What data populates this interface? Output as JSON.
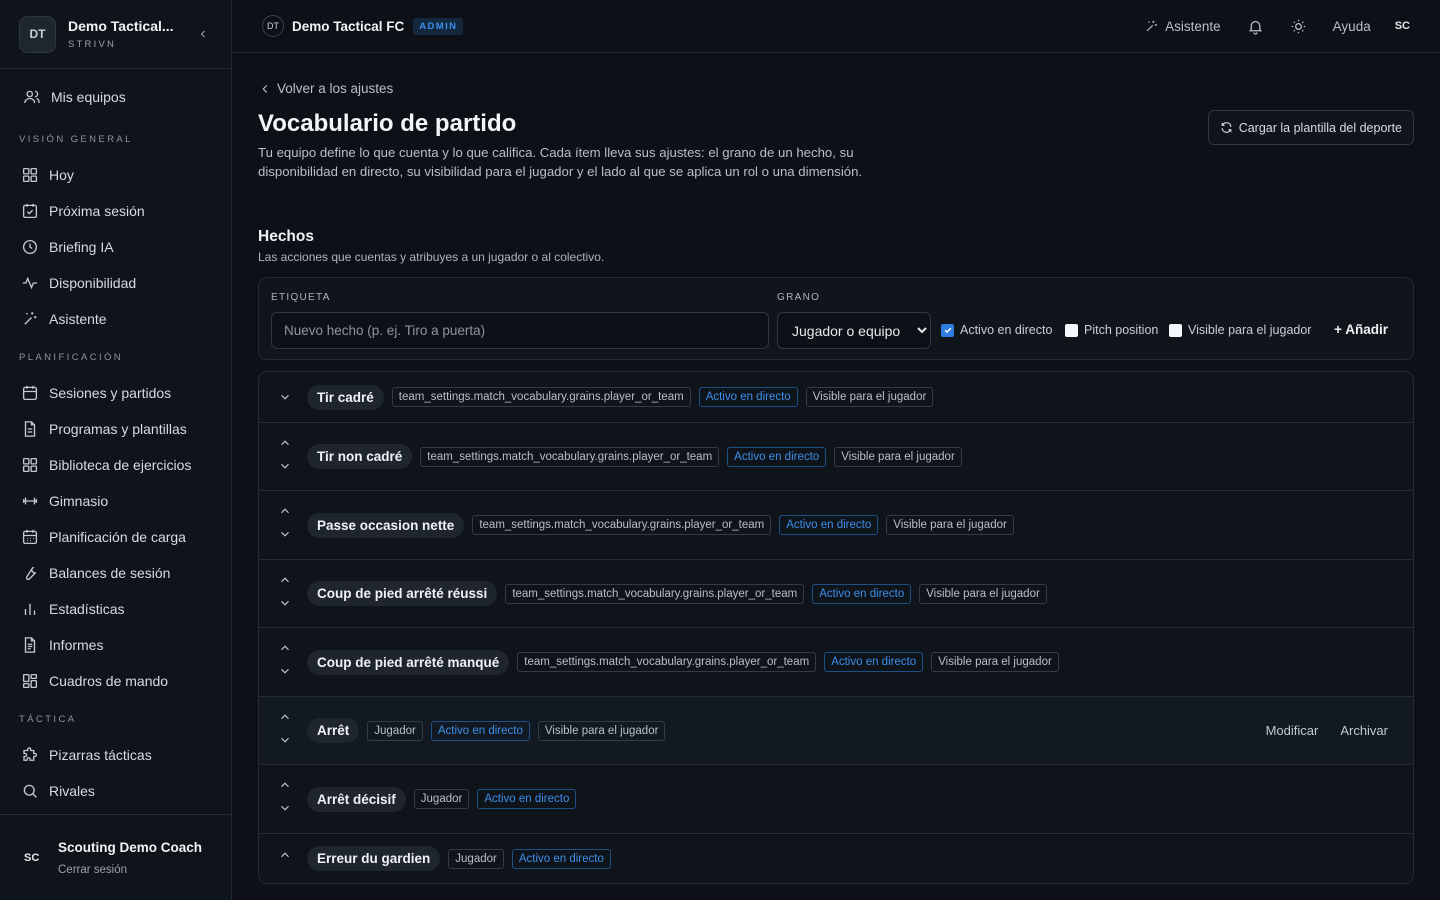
{
  "sidebar": {
    "brand_initials": "DT",
    "brand_name": "Demo Tactical...",
    "brand_sub": "STRIVN",
    "my_teams": "Mis equipos",
    "section_overview": "VISIÓN GENERAL",
    "overview": [
      "Hoy",
      "Próxima sesión",
      "Briefing IA",
      "Disponibilidad",
      "Asistente"
    ],
    "section_planning": "PLANIFICACIÓN",
    "planning": [
      "Sesiones y partidos",
      "Programas y plantillas",
      "Biblioteca de ejercicios",
      "Gimnasio",
      "Planificación de carga",
      "Balances de sesión",
      "Estadísticas",
      "Informes",
      "Cuadros de mando"
    ],
    "section_tactics": "TÁCTICA",
    "tactics": [
      "Pizarras tácticas",
      "Rivales"
    ],
    "user_initials": "SC",
    "user_name": "Scouting Demo Coach",
    "logout": "Cerrar sesión"
  },
  "topbar": {
    "team_initials": "DT",
    "team_name": "Demo Tactical FC",
    "badge": "ADMIN",
    "assistant": "Asistente",
    "help": "Ayuda",
    "me": "SC"
  },
  "main": {
    "back": "Volver a los ajustes",
    "title": "Vocabulario de partido",
    "description": "Tu equipo define lo que cuenta y lo que califica. Cada ítem lleva sus ajustes: el grano de un hecho, su disponibilidad en directo, su visibilidad para el jugador y el lado al que se aplica un rol o una dimensión.",
    "load_template": "Cargar la plantilla del deporte",
    "section_title": "Hechos",
    "section_desc": "Las acciones que cuentas y atribuyes a un jugador o al colectivo.",
    "form": {
      "label_label": "ETIQUETA",
      "label_placeholder": "Nuevo hecho (p. ej. Tiro a puerta)",
      "grain_label": "GRANO",
      "grain_value": "Jugador o equipo",
      "live": "Activo en directo",
      "pitch": "Pitch position",
      "visible": "Visible para el jugador",
      "add": "+ Añadir"
    }
  },
  "facts": [
    {
      "name": "Tir cadré",
      "tags": [
        "team_settings.match_vocabulary.grains.player_or_team",
        "Activo en directo",
        "Visible para el jugador"
      ]
    },
    {
      "name": "Tir non cadré",
      "tags": [
        "team_settings.match_vocabulary.grains.player_or_team",
        "Activo en directo",
        "Visible para el jugador"
      ]
    },
    {
      "name": "Passe occasion nette",
      "tags": [
        "team_settings.match_vocabulary.grains.player_or_team",
        "Activo en directo",
        "Visible para el jugador"
      ]
    },
    {
      "name": "Coup de pied arrêté réussi",
      "tags": [
        "team_settings.match_vocabulary.grains.player_or_team",
        "Activo en directo",
        "Visible para el jugador"
      ]
    },
    {
      "name": "Coup de pied arrêté manqué",
      "tags": [
        "team_settings.match_vocabulary.grains.player_or_team",
        "Activo en directo",
        "Visible para el jugador"
      ]
    },
    {
      "name": "Arrêt",
      "tags": [
        "Jugador",
        "Activo en directo",
        "Visible para el jugador"
      ],
      "actions": [
        "Modificar",
        "Archivar"
      ]
    },
    {
      "name": "Arrêt décisif",
      "tags": [
        "Jugador",
        "Activo en directo"
      ]
    },
    {
      "name": "Erreur du gardien",
      "tags": [
        "Jugador",
        "Activo en directo"
      ]
    }
  ],
  "colors": {
    "accent": "#3b8eea",
    "background": "#0d1117"
  }
}
